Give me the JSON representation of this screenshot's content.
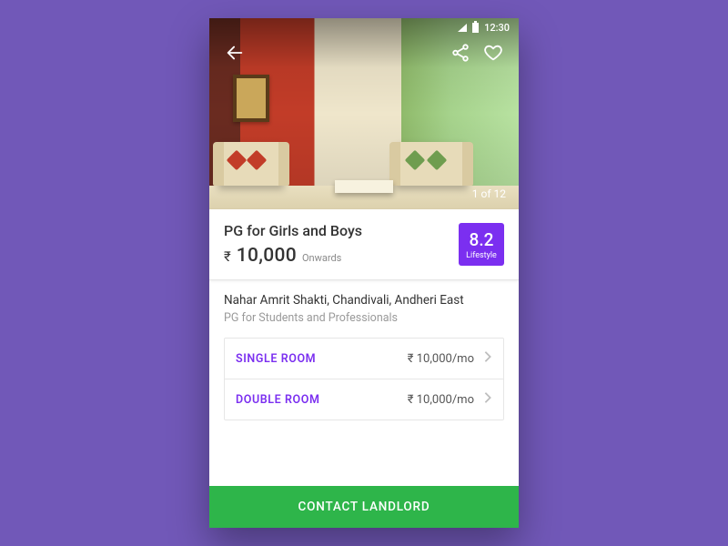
{
  "statusbar": {
    "time": "12:30"
  },
  "hero": {
    "counter": "1 of 12"
  },
  "summary": {
    "title": "PG for Girls and Boys",
    "currency": "₹",
    "price": "10,000",
    "price_suffix": "Onwards",
    "rating_score": "8.2",
    "rating_tag": "Lifestyle"
  },
  "details": {
    "address": "Nahar Amrit Shakti, Chandivali, Andheri East",
    "subtitle": "PG for Students and Professionals"
  },
  "rooms": [
    {
      "name": "SINGLE ROOM",
      "price": "₹ 10,000/mo"
    },
    {
      "name": "DOUBLE ROOM",
      "price": "₹ 10,000/mo"
    }
  ],
  "cta": {
    "label": "CONTACT LANDLORD"
  }
}
